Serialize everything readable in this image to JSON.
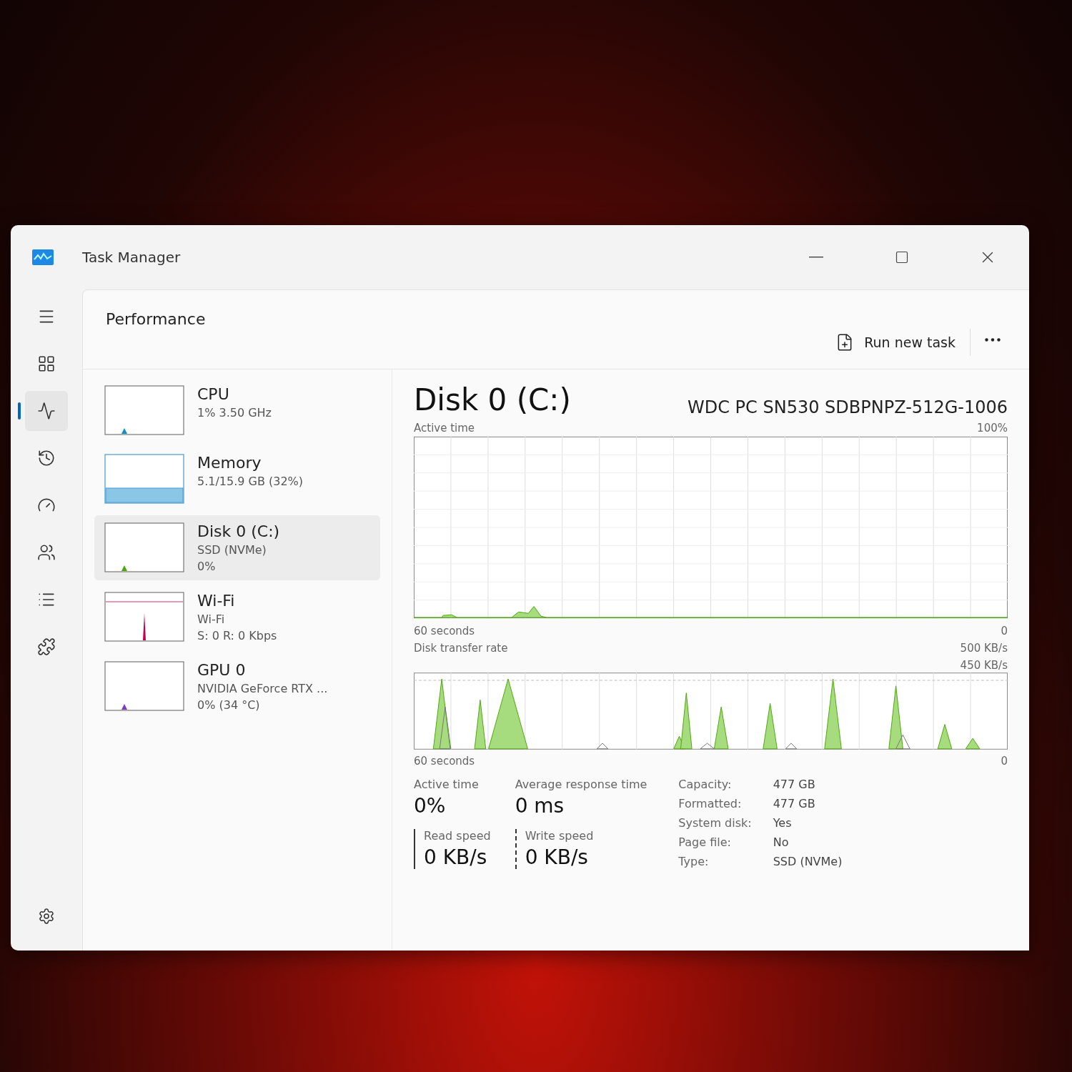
{
  "window": {
    "title": "Task Manager"
  },
  "nav": [
    {
      "kind": "menu",
      "selected": false
    },
    {
      "kind": "processes",
      "selected": false
    },
    {
      "kind": "performance",
      "selected": true
    },
    {
      "kind": "history",
      "selected": false
    },
    {
      "kind": "startup",
      "selected": false
    },
    {
      "kind": "users",
      "selected": false
    },
    {
      "kind": "details",
      "selected": false
    },
    {
      "kind": "services",
      "selected": false
    }
  ],
  "page_title": "Performance",
  "toolbar": {
    "run_task": "Run new task"
  },
  "resources": [
    {
      "kind": "cpu",
      "name": "CPU",
      "lines": [
        "1% 3.50 GHz"
      ],
      "selected": false
    },
    {
      "kind": "memory",
      "name": "Memory",
      "lines": [
        "5.1/15.9 GB (32%)"
      ],
      "selected": false
    },
    {
      "kind": "disk",
      "name": "Disk 0 (C:)",
      "lines": [
        "SSD (NVMe)",
        "0%"
      ],
      "selected": true
    },
    {
      "kind": "wifi",
      "name": "Wi-Fi",
      "lines": [
        "Wi-Fi",
        "S: 0 R: 0 Kbps"
      ],
      "selected": false
    },
    {
      "kind": "gpu",
      "name": "GPU 0",
      "lines": [
        "NVIDIA GeForce RTX ...",
        "0% (34 °C)"
      ],
      "selected": false
    }
  ],
  "detail": {
    "title": "Disk 0 (C:)",
    "model": "WDC PC SN530 SDBPNPZ-512G-1006",
    "active_chart": {
      "label": "Active time",
      "max": "100%",
      "min": "0",
      "span": "60 seconds"
    },
    "transfer_chart": {
      "label": "Disk transfer rate",
      "max": "500 KB/s",
      "mid": "450 KB/s",
      "min": "0",
      "span": "60 seconds"
    },
    "stats": [
      {
        "label": "Active time",
        "value": "0%"
      },
      {
        "label": "Average response time",
        "value": "0 ms"
      }
    ],
    "speeds": [
      {
        "kind": "read",
        "label": "Read speed",
        "value": "0 KB/s"
      },
      {
        "kind": "write",
        "label": "Write speed",
        "value": "0 KB/s"
      }
    ],
    "properties": [
      {
        "label": "Capacity:",
        "value": "477 GB"
      },
      {
        "label": "Formatted:",
        "value": "477 GB"
      },
      {
        "label": "System disk:",
        "value": "Yes"
      },
      {
        "label": "Page file:",
        "value": "No"
      },
      {
        "label": "Type:",
        "value": "SSD (NVMe)"
      }
    ]
  }
}
